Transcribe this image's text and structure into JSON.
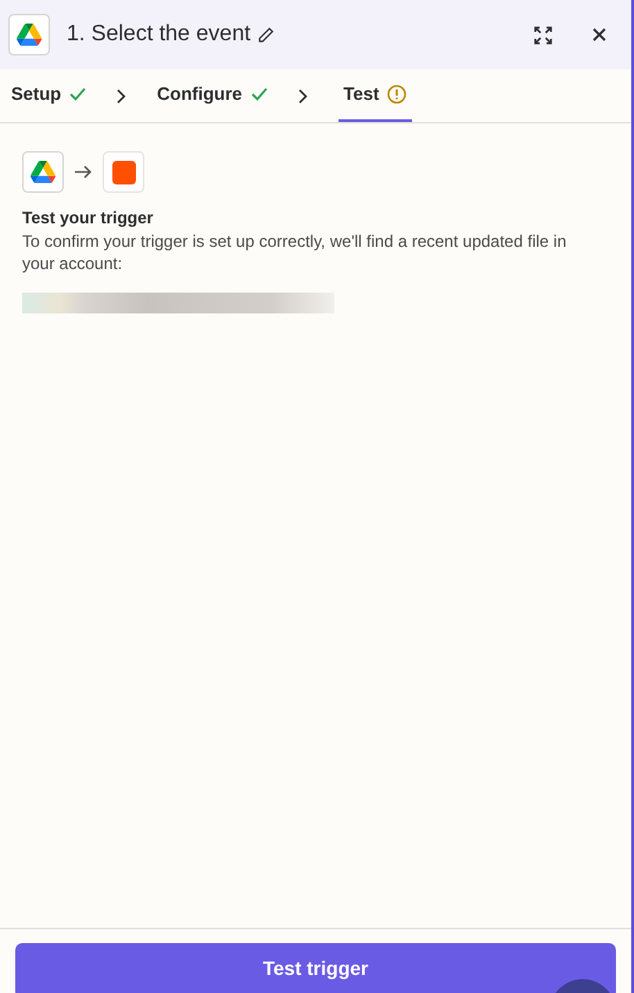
{
  "header": {
    "title": "1. Select the event"
  },
  "steps": [
    {
      "label": "Setup",
      "kind": "done",
      "selected": false
    },
    {
      "label": "Configure",
      "kind": "done",
      "selected": false
    },
    {
      "label": "Test",
      "kind": "warning",
      "selected": true
    }
  ],
  "content": {
    "heading": "Test your trigger",
    "description": "To confirm your trigger is set up correctly, we'll find a recent updated file in your account:"
  },
  "footer": {
    "button": "Test trigger"
  }
}
